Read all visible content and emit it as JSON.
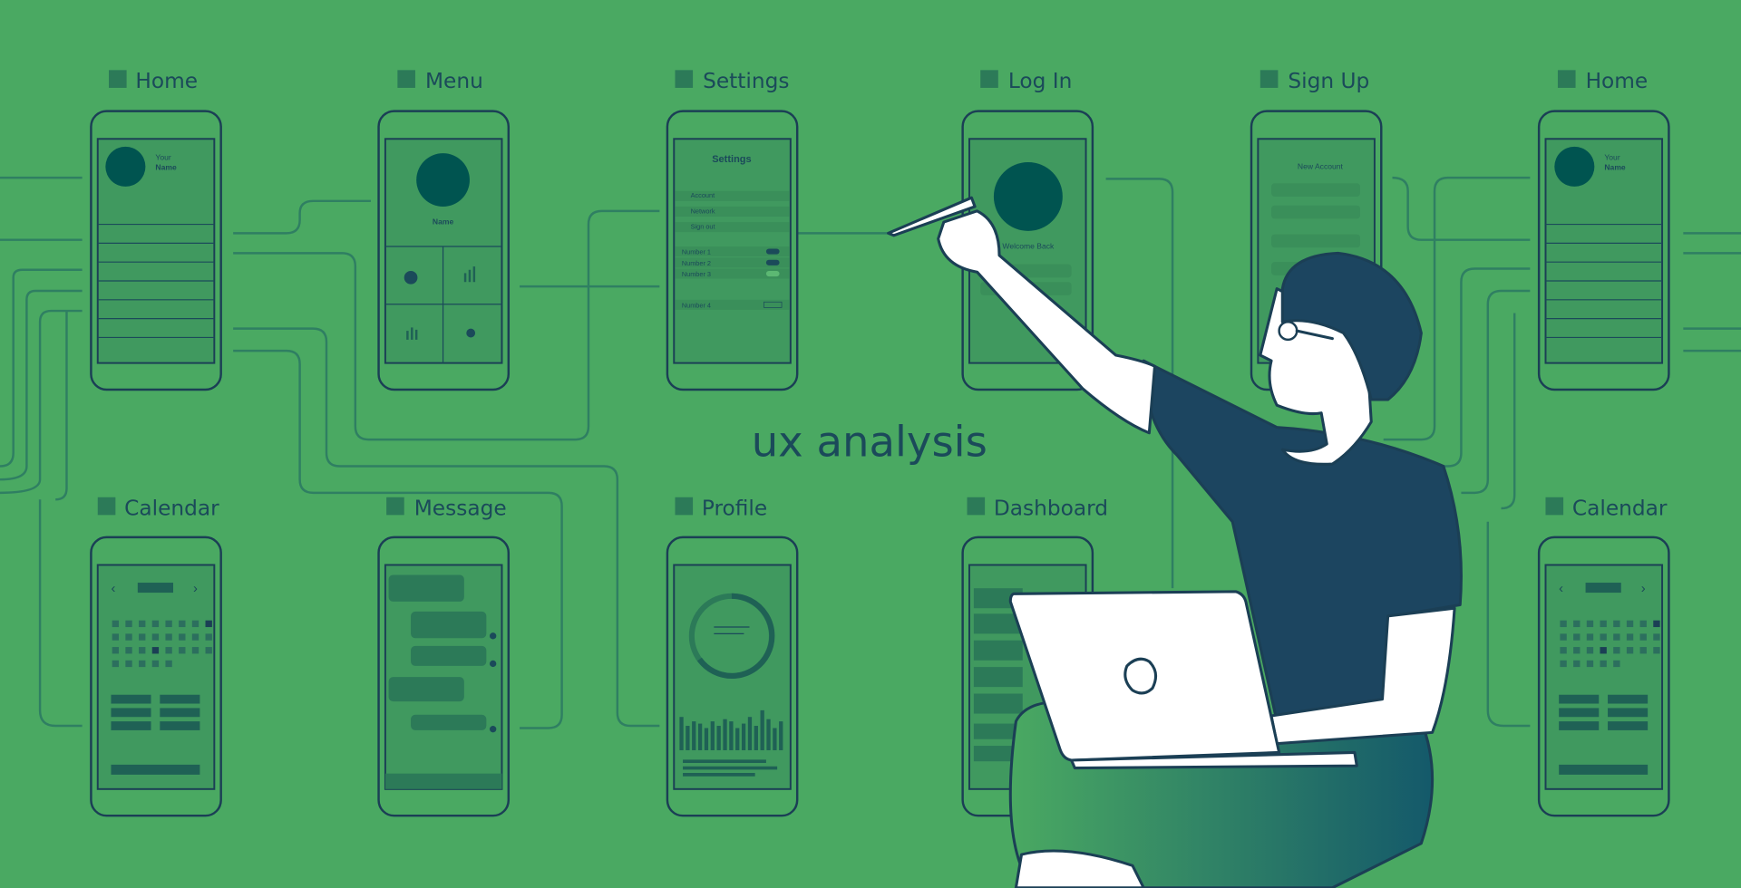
{
  "headline": "ux analysis",
  "screens": {
    "home_top": {
      "title": "Home",
      "your": "Your",
      "name": "Name"
    },
    "menu": {
      "title": "Menu",
      "name": "Name"
    },
    "settings": {
      "title": "Settings",
      "heading": "Settings",
      "items": [
        "Account",
        "Network",
        "Sign out"
      ],
      "toggles": [
        "Number 1",
        "Number 2",
        "Number 3"
      ],
      "stepper": "Number 4"
    },
    "login": {
      "title": "Log In",
      "welcome": "Welcome Back"
    },
    "signup": {
      "title": "Sign Up",
      "heading": "New Account"
    },
    "home_right": {
      "title": "Home",
      "your": "Your",
      "name": "Name"
    },
    "calendar_left": {
      "title": "Calendar"
    },
    "message": {
      "title": "Message"
    },
    "profile": {
      "title": "Profile"
    },
    "dashboard": {
      "title": "Dashboard"
    },
    "calendar_right": {
      "title": "Calendar"
    }
  },
  "colors": {
    "background": "#4aa962",
    "screen": "#40995f",
    "outline": "#1b3f55",
    "accent_circle": "#005450",
    "figure_navy": "#1c4560"
  }
}
